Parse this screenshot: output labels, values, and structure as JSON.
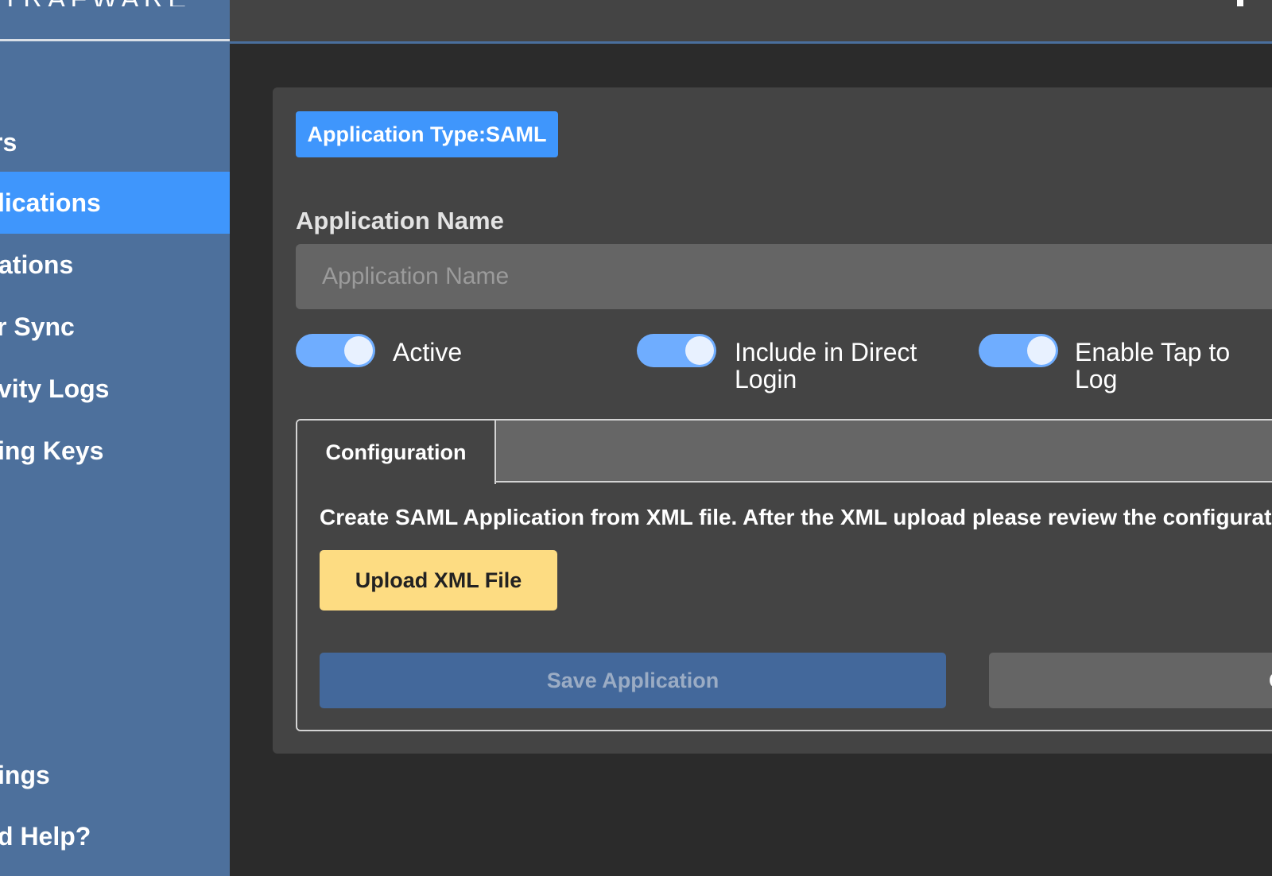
{
  "sidebar": {
    "logo": "TRAFWARE",
    "items": [
      {
        "label": "Users",
        "visible": "rs"
      },
      {
        "label": "Applications",
        "visible": "lications",
        "active": true
      },
      {
        "label": "Integrations",
        "visible": "ations"
      },
      {
        "label": "User Sync",
        "visible": "r Sync"
      },
      {
        "label": "Activity Logs",
        "visible": "vity Logs"
      },
      {
        "label": "Signing Keys",
        "visible": "ing Keys"
      }
    ],
    "bottom_items": [
      {
        "label": "Settings",
        "visible": "ings"
      },
      {
        "label": "Need Help?",
        "visible": "d Help?"
      }
    ]
  },
  "main": {
    "type_badge": "Application Type:SAML",
    "name_label": "Application Name",
    "name_input": {
      "value": "",
      "placeholder": "Application Name"
    },
    "toggles": [
      {
        "label": "Active",
        "on": true
      },
      {
        "label": "Include in Direct\nLogin",
        "on": true
      },
      {
        "label": "Enable Tap to Log",
        "on": true
      }
    ],
    "tabs": [
      {
        "label": "Configuration",
        "active": true
      }
    ],
    "config": {
      "description": "Create SAML Application from XML file. After the XML upload please review the configuratio",
      "upload_label": "Upload XML File",
      "save_label": "Save Application",
      "cancel_label": "C"
    }
  },
  "colors": {
    "sidebar_bg": "#4d709c",
    "active_nav": "#3f96fc",
    "badge": "#3f96fc",
    "toggle_on": "#6fadff",
    "upload_button": "#fddc82",
    "save_button": "#43689b",
    "panel_bg": "#444444",
    "page_bg": "#2b2b2b"
  }
}
